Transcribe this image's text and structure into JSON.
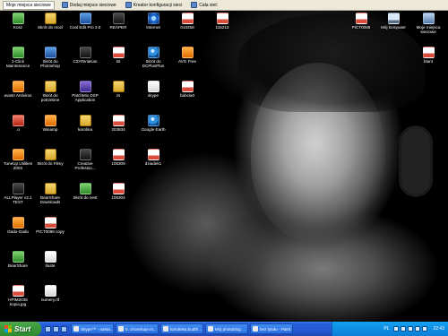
{
  "toolbar": {
    "items": [
      {
        "label": "Moje miejsca sieciowe",
        "icon": "network-places-icon"
      },
      {
        "label": "Dodaj miejsce sieciowe",
        "icon": "add-network-place-icon"
      },
      {
        "label": "Kreator konfiguracji sieci",
        "icon": "network-wizard-icon"
      },
      {
        "label": "Cała sieć",
        "icon": "entire-network-icon"
      }
    ]
  },
  "desktop": {
    "icons": [
      {
        "label": "Kosz",
        "icon": "recycle-bin-icon"
      },
      {
        "label": "Skrót do mozi",
        "icon": "shortcut-icon"
      },
      {
        "label": "Cool Edit Pro 2.0",
        "icon": "audio-app-icon"
      },
      {
        "label": "REAPER",
        "icon": "reaper-icon"
      },
      {
        "label": "Internet",
        "icon": "internet-explorer-icon"
      },
      {
        "label": "010258",
        "icon": "image-file-icon"
      },
      {
        "label": "115213",
        "icon": "image-file-icon"
      },
      {
        "label": "PICT0088",
        "icon": "image-file-icon"
      },
      {
        "label": "Mój komputer",
        "icon": "my-computer-icon"
      },
      {
        "label": "Moje miejsca sieciowe",
        "icon": "network-places-icon"
      },
      {
        "label": "1-Click Maintenance",
        "icon": "maintenance-icon"
      },
      {
        "label": "Skrót do Photoshop",
        "icon": "photoshop-icon"
      },
      {
        "label": "CZATeriaKan",
        "icon": "chat-icon"
      },
      {
        "label": "lot",
        "icon": "image-file-icon"
      },
      {
        "label": "Skrót do DCPlusPlus",
        "icon": "dcplusplus-icon"
      },
      {
        "label": "AVG Free",
        "icon": "avg-icon"
      },
      {
        "label": "blant",
        "icon": "image-file-icon"
      },
      {
        "label": "avast! Antivirus",
        "icon": "avast-icon"
      },
      {
        "label": "Skrót do potrzebne",
        "icon": "folder-shortcut-icon"
      },
      {
        "label": "PatchMix DSP Application",
        "icon": "patchmix-icon"
      },
      {
        "label": "zs",
        "icon": "folder-icon"
      },
      {
        "label": "skype",
        "icon": "document-icon"
      },
      {
        "label": "babcia0",
        "icon": "image-file-icon"
      },
      {
        "label": ".o",
        "icon": "red-app-icon"
      },
      {
        "label": "Winamp",
        "icon": "winamp-icon"
      },
      {
        "label": "karolina",
        "icon": "folder-icon"
      },
      {
        "label": "203934",
        "icon": "image-file-icon"
      },
      {
        "label": "Google Earth",
        "icon": "google-earth-icon"
      },
      {
        "label": "TuneUp Utilities 2004",
        "icon": "tuneup-icon"
      },
      {
        "label": "Skrót do Filmy",
        "icon": "folder-shortcut-icon"
      },
      {
        "label": "Creative Professio...",
        "icon": "creative-icon"
      },
      {
        "label": "105309",
        "icon": "image-file-icon"
      },
      {
        "label": "dziadek1",
        "icon": "image-file-icon"
      },
      {
        "label": "ALLPlayer v2.1 TEST",
        "icon": "allplayer-icon"
      },
      {
        "label": "BearShare Downloads",
        "icon": "bearshare-folder-icon"
      },
      {
        "label": "Skrót do nest",
        "icon": "nest-icon"
      },
      {
        "label": "105304",
        "icon": "image-file-icon"
      },
      {
        "label": "Gadu-Gadu",
        "icon": "gadu-gadu-icon"
      },
      {
        "label": "PICT0088 copy",
        "icon": "image-file-icon"
      },
      {
        "label": "BearShare",
        "icon": "bearshare-icon"
      },
      {
        "label": "tluste",
        "icon": "document-icon"
      },
      {
        "label": "HPIM2035 kopia.jpg",
        "icon": "image-file-icon"
      },
      {
        "label": "numery.rtf",
        "icon": "document-icon"
      }
    ]
  },
  "taskbar": {
    "start_label": "Start",
    "tasks": [
      {
        "label": "Skype™ - nasta..."
      },
      {
        "label": "5. chomikuje.m..."
      },
      {
        "label": "karolinka.budth..."
      },
      {
        "label": "Mój photoblog ..."
      },
      {
        "label": "bez tytułu - Paint"
      }
    ],
    "tray": {
      "lang": "PL",
      "clock": "22:43"
    }
  }
}
